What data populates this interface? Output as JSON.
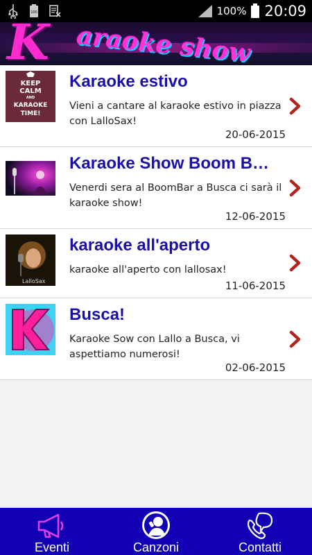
{
  "statusbar": {
    "battery_pct": "100%",
    "time": "20:09",
    "icons": [
      "usb-icon",
      "battery-100-icon",
      "notification-x-icon",
      "signal-icon",
      "battery-icon"
    ]
  },
  "banner": {
    "k_letter": "K",
    "text": "araoke show"
  },
  "events": [
    {
      "title": "Karaoke estivo",
      "desc": "Vieni a cantare al karaoke estivo in piazza con LalloSax!",
      "date": "20-06-2015",
      "thumb": "keep-calm-karaoke"
    },
    {
      "title": "Karaoke Show Boom Bar…",
      "desc": "Venerdi sera al BoomBar a Busca ci sarà il karaoke show!",
      "date": "12-06-2015",
      "thumb": "microphone-stage"
    },
    {
      "title": "karaoke all'aperto",
      "desc": "karaoke all'aperto con lallosax!",
      "date": "11-06-2015",
      "thumb": "singer-portrait"
    },
    {
      "title": "Busca!",
      "desc": "Karaoke Sow con Lallo a Busca, vi aspettiamo numerosi!",
      "date": "02-06-2015",
      "thumb": "k-logo"
    }
  ],
  "thumbs": {
    "keep_calm": [
      "KEEP",
      "CALM",
      "AND",
      "KARAOKE",
      "TIME!"
    ],
    "lallosax": "LalloSax"
  },
  "nav": {
    "eventi": "Eventi",
    "canzoni": "Canzoni",
    "contatti": "Contatti"
  },
  "colors": {
    "title": "#1a0fa8",
    "nav_bg": "#1100b4",
    "chevron": "#b0231e",
    "accent_pink": "#ff2bd0"
  }
}
